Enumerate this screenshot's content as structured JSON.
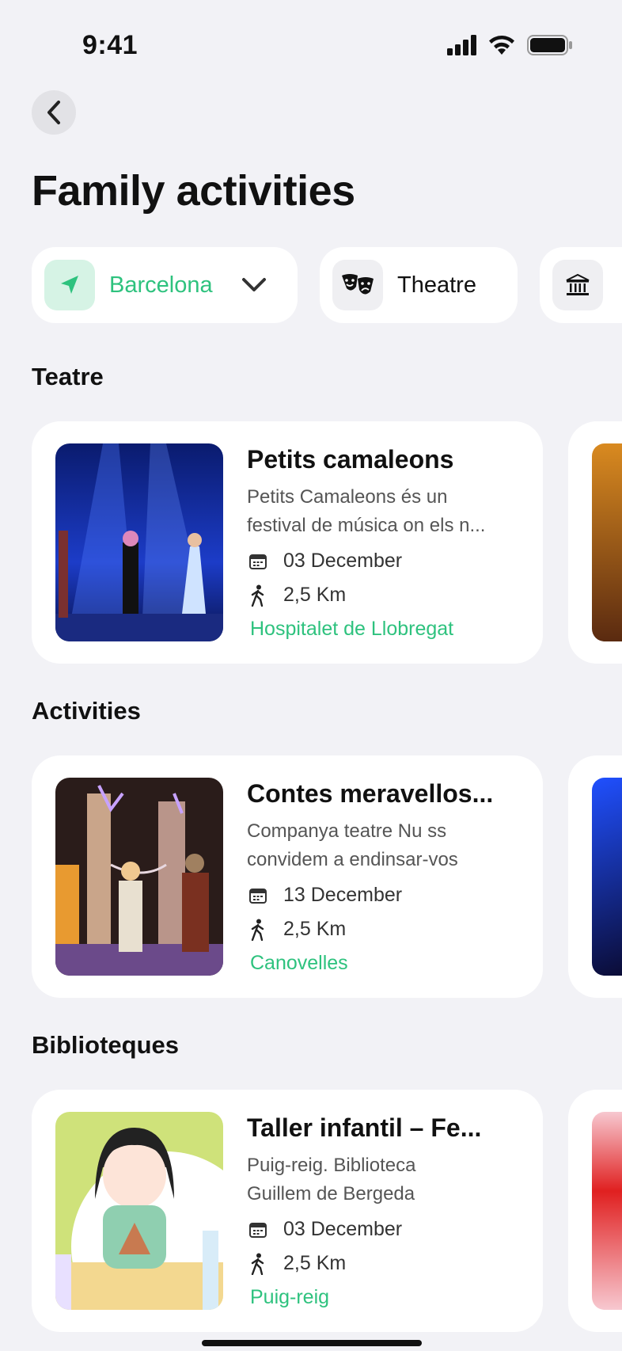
{
  "status_bar": {
    "time": "9:41"
  },
  "header": {
    "title": "Family activities"
  },
  "filters": {
    "location": {
      "label": "Barcelona",
      "icon": "location-arrow-icon"
    },
    "category": {
      "label": "Theatre",
      "icon": "theatre-masks-icon"
    },
    "next": {
      "icon": "museum-icon"
    }
  },
  "sections": [
    {
      "title": "Teatre",
      "card": {
        "title": "Petits camaleons",
        "desc_line1": "Petits Camaleons és un",
        "desc_line2": "festival de música on els n...",
        "date": "03 December",
        "distance": "2,5 Km",
        "place": "Hospitalet de Llobregat"
      }
    },
    {
      "title": "Activities",
      "card": {
        "title": "Contes meravellos...",
        "desc_line1": "Companya teatre Nu ss",
        "desc_line2": "convidem a endinsar-vos",
        "date": "13 December",
        "distance": "2,5 Km",
        "place": "Canovelles"
      }
    },
    {
      "title": "Biblioteques",
      "card": {
        "title": "Taller infantil – Fe...",
        "desc_line1": "Puig-reig. Biblioteca",
        "desc_line2": "Guillem de Bergeda",
        "date": "03 December",
        "distance": "2,5 Km",
        "place": "Puig-reig"
      }
    }
  ],
  "colors": {
    "accent": "#2ec27e",
    "background": "#f2f2f6",
    "card": "#ffffff"
  }
}
